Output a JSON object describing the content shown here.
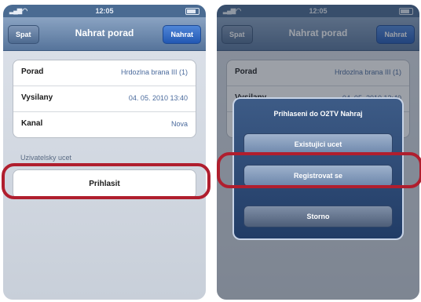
{
  "status": {
    "time": "12:05"
  },
  "nav": {
    "title": "Nahrat porad",
    "back": "Spat",
    "send": "Nahrat"
  },
  "table": [
    {
      "label": "Porad",
      "value": "Hrdozlna brana III (1)"
    },
    {
      "label": "Vysilany",
      "value": "04. 05. 2010 13:40"
    },
    {
      "label": "Kanal",
      "value": "Nova"
    }
  ],
  "account": {
    "section": "Uzivatelsky ucet",
    "login": "Prihlasit"
  },
  "sheet": {
    "title": "Prihlaseni do O2TV Nahraj",
    "buttons": [
      "Existujici ucet",
      "Registrovat se",
      "Storno"
    ]
  },
  "highlight_color": "#b01e2e"
}
